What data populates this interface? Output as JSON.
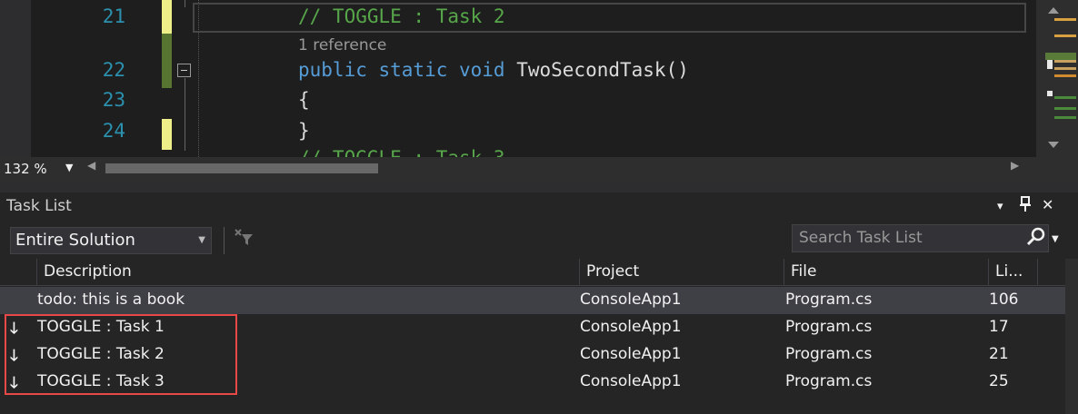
{
  "editor": {
    "lines": [
      {
        "number": "21",
        "code": "// TOGGLE : Task 2"
      },
      {
        "number": "22",
        "keywords": "public static void ",
        "ident": "TwoSecondTask()"
      },
      {
        "number": "23",
        "code": "{"
      },
      {
        "number": "24",
        "code": "}"
      },
      {
        "partial_code": "// TOGGLE : Task 3"
      }
    ],
    "codelens": "1 reference",
    "zoom": "132 %"
  },
  "task_list": {
    "title": "Task List",
    "scope": "Entire Solution",
    "search_placeholder": "Search Task List",
    "columns": [
      "Description",
      "Project",
      "File",
      "Li..."
    ],
    "rows": [
      {
        "description": "todo: this is a book",
        "project": "ConsoleApp1",
        "file": "Program.cs",
        "line": "106",
        "icon": ""
      },
      {
        "description": "TOGGLE : Task 1",
        "project": "ConsoleApp1",
        "file": "Program.cs",
        "line": "17",
        "icon": "🡓"
      },
      {
        "description": "TOGGLE : Task 2",
        "project": "ConsoleApp1",
        "file": "Program.cs",
        "line": "21",
        "icon": "🡓"
      },
      {
        "description": "TOGGLE : Task 3",
        "project": "ConsoleApp1",
        "file": "Program.cs",
        "line": "25",
        "icon": "🡓"
      }
    ],
    "buttons": {
      "dropdown": "▾",
      "pin": "⊥",
      "close": "✕"
    }
  },
  "colors": {
    "accent_highlight": "#e84848",
    "line_number": "#2b91af",
    "comment": "#57a64a",
    "keyword": "#569cd6"
  },
  "icons": [
    "collapse-icon",
    "filter-icon",
    "search-icon",
    "down-arrow-icon",
    "pin-icon",
    "close-icon"
  ]
}
